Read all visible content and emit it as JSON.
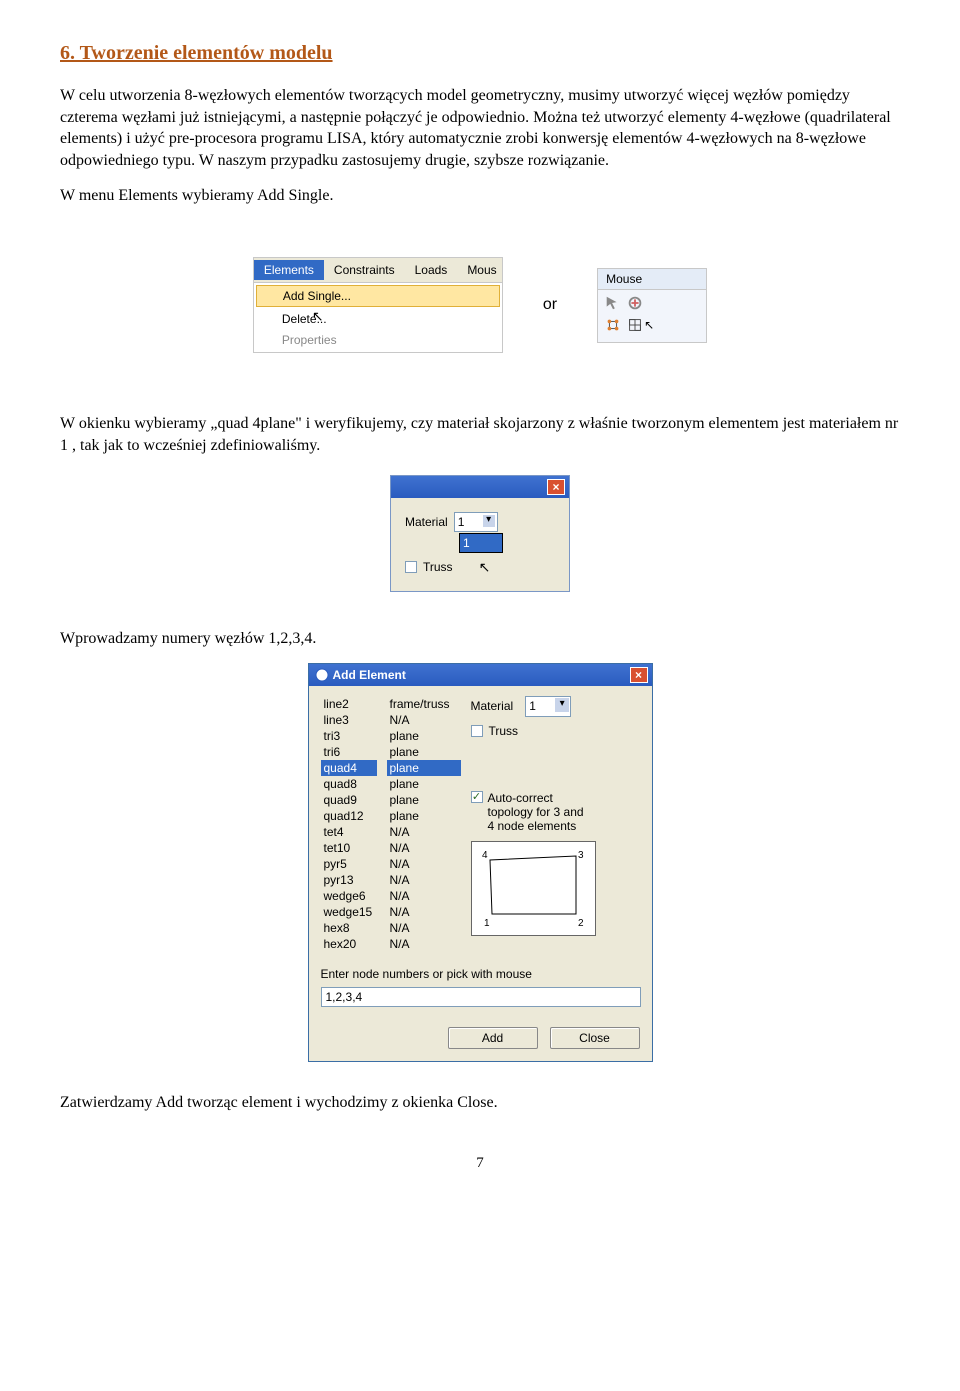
{
  "heading": "6. Tworzenie elementów modelu",
  "para1": "W celu utworzenia 8-węzłowych elementów tworzących model geometryczny, musimy utworzyć więcej węzłów pomiędzy czterema węzłami już istniejącymi, a następnie połączyć je odpowiednio. Można też utworzyć elementy  4-węzłowe (quadrilateral elements) i użyć pre-procesora programu LISA, który automatycznie zrobi konwersję elementów 4-węzłowych na 8-węzłowe odpowiedniego typu. W naszym przypadku zastosujemy drugie, szybsze rozwiązanie.",
  "para2": "W menu Elements wybieramy Add Single.",
  "menu1": {
    "items": [
      "Elements",
      "Constraints",
      "Loads",
      "Mous"
    ],
    "sub": [
      "Add Single...",
      "Delete...",
      "Properties"
    ]
  },
  "or": "or",
  "menu2": {
    "label": "Mouse"
  },
  "para3": "W okienku wybieramy „quad 4plane\" i weryfikujemy, czy  materiał skojarzony z właśnie tworzonym elementem jest materiałem nr 1 , tak jak to wcześniej zdefiniowaliśmy.",
  "mat": {
    "label": "Material",
    "value": "1",
    "option": "1",
    "chk_label": "Truss"
  },
  "para4": "Wprowadzamy numery węzłów 1,2,3,4.",
  "dlg": {
    "title": "Add Element",
    "types": [
      [
        "line2",
        "frame/truss"
      ],
      [
        "line3",
        "N/A"
      ],
      [
        "tri3",
        "plane"
      ],
      [
        "tri6",
        "plane"
      ],
      [
        "quad4",
        "plane"
      ],
      [
        "quad8",
        "plane"
      ],
      [
        "quad9",
        "plane"
      ],
      [
        "quad12",
        "plane"
      ],
      [
        "tet4",
        "N/A"
      ],
      [
        "tet10",
        "N/A"
      ],
      [
        "pyr5",
        "N/A"
      ],
      [
        "pyr13",
        "N/A"
      ],
      [
        "wedge6",
        "N/A"
      ],
      [
        "wedge15",
        "N/A"
      ],
      [
        "hex8",
        "N/A"
      ],
      [
        "hex20",
        "N/A"
      ]
    ],
    "selected_index": 4,
    "material_label": "Material",
    "material_value": "1",
    "truss_label": "Truss",
    "autocorrect": "Auto-correct\ntopology for 3 and\n4 node elements",
    "nodes_label": "Enter node numbers or pick with mouse",
    "nodes_value": "1,2,3,4",
    "btn_add": "Add",
    "btn_close": "Close",
    "preview_nodes": [
      "4",
      "3",
      "1",
      "2"
    ]
  },
  "para5": "Zatwierdzamy Add tworząc element  i wychodzimy z okienka Close.",
  "page_number": "7"
}
